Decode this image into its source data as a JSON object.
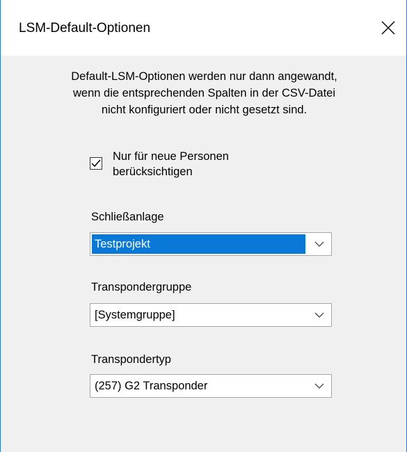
{
  "window": {
    "title": "LSM-Default-Optionen"
  },
  "description": {
    "lines": [
      "Default-LSM-Optionen werden nur dann angewandt,",
      "wenn die entsprechenden Spalten in der CSV-Datei",
      "nicht konfiguriert oder nicht gesetzt sind."
    ]
  },
  "new_persons_checkbox": {
    "checked": true,
    "label_line1": "Nur für neue Personen",
    "label_line2": "berücksichtigen"
  },
  "locking_system": {
    "label": "Schließanlage",
    "value": "Testprojekt"
  },
  "transponder_group": {
    "label": "Transpondergruppe",
    "value": "[Systemgruppe]"
  },
  "transponder_type": {
    "label": "Transpondertyp",
    "value": "(257) G2 Transponder"
  },
  "icons": {
    "close": "close-icon",
    "check": "checkmark-icon",
    "dropdown": "chevron-down-icon"
  },
  "colors": {
    "window_border": "#2b79d8",
    "selection": "#0a78d7",
    "background": "#f0f0f0"
  }
}
